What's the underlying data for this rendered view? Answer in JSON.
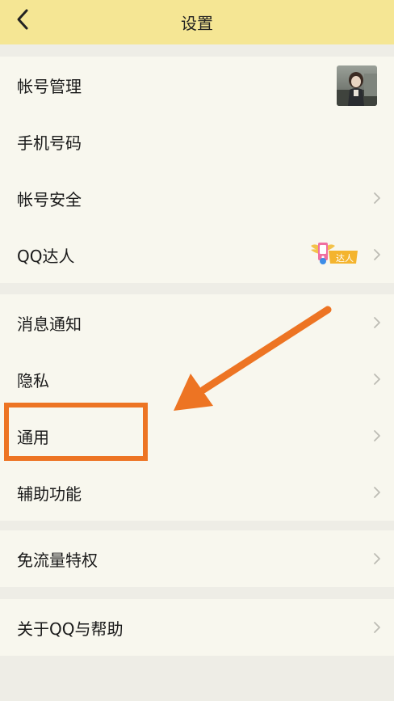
{
  "header": {
    "title": "设置",
    "back_icon": "chevron-left-icon"
  },
  "groups": [
    {
      "items": [
        {
          "label": "帐号管理",
          "accessory": "avatar"
        },
        {
          "label": "手机号码",
          "accessory": "none"
        },
        {
          "label": "帐号安全",
          "accessory": "chevron"
        },
        {
          "label": "QQ达人",
          "accessory": "badge+chevron",
          "badge_text": "达人"
        }
      ]
    },
    {
      "items": [
        {
          "label": "消息通知",
          "accessory": "chevron"
        },
        {
          "label": "隐私",
          "accessory": "chevron"
        },
        {
          "label": "通用",
          "accessory": "chevron",
          "highlighted": true
        },
        {
          "label": "辅助功能",
          "accessory": "chevron"
        }
      ]
    },
    {
      "items": [
        {
          "label": "免流量特权",
          "accessory": "chevron"
        }
      ]
    },
    {
      "items": [
        {
          "label": "关于QQ与帮助",
          "accessory": "chevron"
        }
      ]
    }
  ],
  "annotation": {
    "color": "#ed7423",
    "type": "arrow pointing to highlighted item"
  },
  "colors": {
    "header_bg": "#f5e694",
    "row_bg": "#f8f7ee",
    "page_bg": "#eeede6",
    "chevron": "#bdbcb4"
  }
}
